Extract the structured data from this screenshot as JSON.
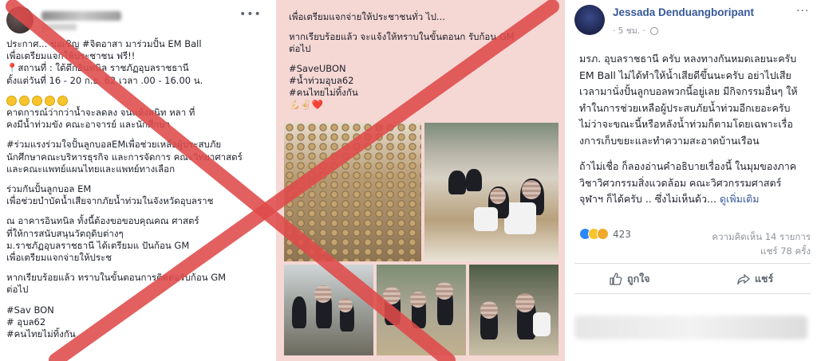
{
  "left_post": {
    "lines": [
      "ประกาศ... ขอเชิญ         #จิตอาสา มาร่วมปั้น EM Ball",
      "เพื่อเตรียมแจกให้ประชาชน  ฟรี!!",
      "📍สถานที่ : ใต้ตึกอินทนิล ราชภัฏอุบลราชธานี",
      "ตั้งแต่วันที่ 16 - 20 ก.ย. 62 เวลา  .00 - 16.00 น.",
      "",
      "EMOJI",
      "คาดการณ์ว่ากว่าน้ำจะลดลง จนแห้งสนิท หลา    ที่",
      "คงมีน้ำท่วมขัง คณะอาจารย์ และนักศึกษา",
      "",
      " #ร่วมแรงร่วมใจปั้นลูกบอลEMเพื่อช่วยเหลือผู้ประสบภัย",
      "นักศึกษาคณะบริหารธุรกิจ และการจัดการ คณะวิทยาศาสตร์",
      "และคณะแพทย์แผนไทยและแพทย์ทางเลือก",
      "",
      "ร่วมกันปั้นลูกบอล EM",
      "เพื่อช่วยบำบัดน้ำเสียจากภัยน้ำท่วมในจังหวัดอุบลราช",
      "",
      "ณ อาคารอินทนิล ทั้งนี้ต้องขอขอบคุณคณ    ศาสตร์",
      "ที่ให้การสนับสนุนวัตถุดิบต่างๆ",
      "ม.ราชภัฏอุบลราชธานี ได้เตรียมแ    ปันก้อน GM",
      "เพื่อเตรียมแจกจ่ายให้ประช",
      "",
      "หากเรียบร้อยแล้ว     ทราบในขั้นตอนการติดต่อรับก้อน  GM",
      "ต่อไป",
      "",
      "#Sav    BON",
      "#     อุบล62",
      "#คนไทยไม่ทิ้งกัน"
    ]
  },
  "middle_post": {
    "lines": [
      "เพื่อเตรียมแจกจ่ายให้ประชาชนทั่ว ไป...",
      "",
      "หากเรียบร้อยแล้ว จะแจ้งให้ทราบในขั้นตอนก          รับก้อน  GM",
      "ต่อไป",
      "",
      "#SaveUBON",
      "#น้ำท่วมอุบล62",
      "#คนไทยไม่ทิ้งกัน",
      "💪🏻✌🏻❤️"
    ]
  },
  "right_post": {
    "author": "Jessada Denduangboripant",
    "time": "· 5 ชม. ·",
    "more_label": "···",
    "body": [
      "มรภ. อุบลราชธานี ครับ หลงทางกันหมดเลยนะครับ",
      "EM Ball ไม่ได้ทำให้น้ำเสียดีขึ้นนะครับ อย่าไปเสีย",
      "เวลามานั่งปั้นลูกบอลพวกนี้อยู่เลย มีกิจกรรมอื่นๆ ให้",
      "ทำในการช่วยเหลือผู้ประสบภัยน้ำท่วมอีกเยอะครับ",
      "ไม่ว่าจะขณะนี้หรือหลังน้ำท่วมก็ตามโดยเฉพาะเรื่อ",
      "งการเก็บขยะและทำความสะอาดบ้านเรือน",
      "",
      "ถ้าไม่เชื่อ ก็ลองอ่านคำอธิบายเรื่องนี้ ในมุมของภาค",
      "วิชาวิศวกรรมสิ่งแวดล้อม คณะวิศวกรรมศาสตร์",
      "จุฬาฯ ก็ได้ครับ .. ซึ่งไม่เห็นด้ว... "
    ],
    "see_more": "ดูเพิ่มเติม",
    "reaction_count": "423",
    "comments": "ความคิดเห็น 14 รายการ",
    "shares": "แชร์ 78 ครั้ง",
    "like_label": "ถูกใจ",
    "share_label": "แชร์"
  },
  "colors": {
    "x_mark": "#e04b4b",
    "link_blue": "#365899",
    "middle_bg": "#f5d7d4"
  }
}
